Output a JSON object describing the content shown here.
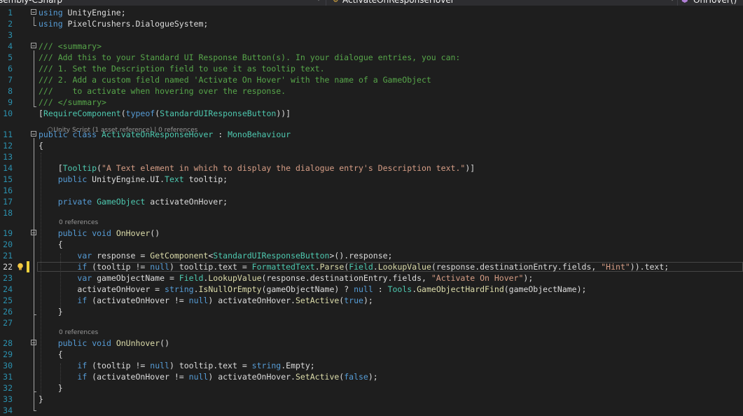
{
  "navbar": {
    "project_dropdown": "sembly-CSharp",
    "class_dropdown": "ActivateOnResponseHover",
    "member_dropdown": "OnHover()"
  },
  "colors": {
    "background": "#1e1e1e",
    "keyword": "#569cd6",
    "type": "#4ec9b0",
    "comment": "#57a64a",
    "string": "#d69d85",
    "method": "#dcdcaa",
    "text": "#dcdcdc",
    "line_number": "#2b91af",
    "modified_marker": "#efd23c"
  },
  "editor": {
    "current_line": 22,
    "code_lens": {
      "class_line10": "Unity Script (1 asset reference) | 0 references",
      "onhover": "0 references",
      "onunhover": "0 references"
    },
    "lightbulb_icon": "lightbulb-icon",
    "lines": [
      {
        "n": "1",
        "t": [
          [
            "kw",
            "using"
          ],
          [
            "tx",
            " UnityEngine;"
          ]
        ]
      },
      {
        "n": "2",
        "t": [
          [
            "kw",
            "using"
          ],
          [
            "tx",
            " PixelCrushers.DialogueSystem;"
          ]
        ]
      },
      {
        "n": "3",
        "t": []
      },
      {
        "n": "4",
        "t": [
          [
            "cm",
            "/// <summary>"
          ]
        ]
      },
      {
        "n": "5",
        "t": [
          [
            "cm",
            "/// Add this to your Standard UI Response Button(s). In your dialogue entries, you can:"
          ]
        ]
      },
      {
        "n": "6",
        "t": [
          [
            "cm",
            "/// 1. Set the Description field to use it as tooltip text."
          ]
        ]
      },
      {
        "n": "7",
        "t": [
          [
            "cm",
            "/// 2. Add a custom field named 'Activate On Hover' with the name of a GameObject"
          ]
        ]
      },
      {
        "n": "8",
        "t": [
          [
            "cm",
            "///    to activate when hovering over the response."
          ]
        ]
      },
      {
        "n": "9",
        "t": [
          [
            "cm",
            "/// </summary>"
          ]
        ]
      },
      {
        "n": "10",
        "t": [
          [
            "tx",
            "["
          ],
          [
            "ty",
            "RequireComponent"
          ],
          [
            "tx",
            "("
          ],
          [
            "kw",
            "typeof"
          ],
          [
            "tx",
            "("
          ],
          [
            "ty",
            "StandardUIResponseButton"
          ],
          [
            "tx",
            "))]"
          ]
        ]
      },
      {
        "n": "11",
        "t": [
          [
            "kw",
            "public"
          ],
          [
            "tx",
            " "
          ],
          [
            "kw",
            "class"
          ],
          [
            "tx",
            " "
          ],
          [
            "ty",
            "ActivateOnResponseHover"
          ],
          [
            "tx",
            " : "
          ],
          [
            "ty",
            "MonoBehaviour"
          ]
        ]
      },
      {
        "n": "12",
        "t": [
          [
            "tx",
            "{"
          ]
        ]
      },
      {
        "n": "13",
        "t": []
      },
      {
        "n": "14",
        "t": [
          [
            "tx",
            "    ["
          ],
          [
            "ty",
            "Tooltip"
          ],
          [
            "tx",
            "("
          ],
          [
            "st",
            "\"A Text element in which to display the dialogue entry's Description text.\""
          ],
          [
            "tx",
            ")]"
          ]
        ]
      },
      {
        "n": "15",
        "t": [
          [
            "tx",
            "    "
          ],
          [
            "kw",
            "public"
          ],
          [
            "tx",
            " UnityEngine.UI."
          ],
          [
            "ty",
            "Text"
          ],
          [
            "tx",
            " tooltip;"
          ]
        ]
      },
      {
        "n": "16",
        "t": []
      },
      {
        "n": "17",
        "t": [
          [
            "tx",
            "    "
          ],
          [
            "kw",
            "private"
          ],
          [
            "tx",
            " "
          ],
          [
            "ty",
            "GameObject"
          ],
          [
            "tx",
            " activateOnHover;"
          ]
        ]
      },
      {
        "n": "18",
        "t": []
      },
      {
        "n": "19",
        "t": [
          [
            "tx",
            "    "
          ],
          [
            "kw",
            "public"
          ],
          [
            "tx",
            " "
          ],
          [
            "kw",
            "void"
          ],
          [
            "tx",
            " "
          ],
          [
            "me",
            "OnHover"
          ],
          [
            "tx",
            "()"
          ]
        ]
      },
      {
        "n": "20",
        "t": [
          [
            "tx",
            "    {"
          ]
        ]
      },
      {
        "n": "21",
        "t": [
          [
            "tx",
            "        "
          ],
          [
            "kw",
            "var"
          ],
          [
            "tx",
            " response = "
          ],
          [
            "me",
            "GetComponent"
          ],
          [
            "tx",
            "<"
          ],
          [
            "ty",
            "StandardUIResponseButton"
          ],
          [
            "tx",
            ">().response;"
          ]
        ]
      },
      {
        "n": "22",
        "t": [
          [
            "tx",
            "        "
          ],
          [
            "kw",
            "if"
          ],
          [
            "tx",
            " (tooltip != "
          ],
          [
            "kw",
            "null"
          ],
          [
            "tx",
            ") tooltip.text = "
          ],
          [
            "ty",
            "FormattedText"
          ],
          [
            "tx",
            "."
          ],
          [
            "me",
            "Parse"
          ],
          [
            "tx",
            "("
          ],
          [
            "ty",
            "Field"
          ],
          [
            "tx",
            "."
          ],
          [
            "me",
            "LookupValue"
          ],
          [
            "tx",
            "(response.destinationEntry.fields, "
          ],
          [
            "st",
            "\"Hint\""
          ],
          [
            "tx",
            ")).text;"
          ]
        ]
      },
      {
        "n": "23",
        "t": [
          [
            "tx",
            "        "
          ],
          [
            "kw",
            "var"
          ],
          [
            "tx",
            " gameObjectName = "
          ],
          [
            "ty",
            "Field"
          ],
          [
            "tx",
            "."
          ],
          [
            "me",
            "LookupValue"
          ],
          [
            "tx",
            "(response.destinationEntry.fields, "
          ],
          [
            "st",
            "\"Activate On Hover\""
          ],
          [
            "tx",
            ");"
          ]
        ]
      },
      {
        "n": "24",
        "t": [
          [
            "tx",
            "        activateOnHover = "
          ],
          [
            "kw",
            "string"
          ],
          [
            "tx",
            "."
          ],
          [
            "me",
            "IsNullOrEmpty"
          ],
          [
            "tx",
            "(gameObjectName) ? "
          ],
          [
            "kw",
            "null"
          ],
          [
            "tx",
            " : "
          ],
          [
            "ty",
            "Tools"
          ],
          [
            "tx",
            "."
          ],
          [
            "me",
            "GameObjectHardFind"
          ],
          [
            "tx",
            "(gameObjectName);"
          ]
        ]
      },
      {
        "n": "25",
        "t": [
          [
            "tx",
            "        "
          ],
          [
            "kw",
            "if"
          ],
          [
            "tx",
            " (activateOnHover != "
          ],
          [
            "kw",
            "null"
          ],
          [
            "tx",
            ") activateOnHover."
          ],
          [
            "me",
            "SetActive"
          ],
          [
            "tx",
            "("
          ],
          [
            "kw",
            "true"
          ],
          [
            "tx",
            ");"
          ]
        ]
      },
      {
        "n": "26",
        "t": [
          [
            "tx",
            "    }"
          ]
        ]
      },
      {
        "n": "27",
        "t": []
      },
      {
        "n": "28",
        "t": [
          [
            "tx",
            "    "
          ],
          [
            "kw",
            "public"
          ],
          [
            "tx",
            " "
          ],
          [
            "kw",
            "void"
          ],
          [
            "tx",
            " "
          ],
          [
            "me",
            "OnUnhover"
          ],
          [
            "tx",
            "()"
          ]
        ]
      },
      {
        "n": "29",
        "t": [
          [
            "tx",
            "    {"
          ]
        ]
      },
      {
        "n": "30",
        "t": [
          [
            "tx",
            "        "
          ],
          [
            "kw",
            "if"
          ],
          [
            "tx",
            " (tooltip != "
          ],
          [
            "kw",
            "null"
          ],
          [
            "tx",
            ") tooltip.text = "
          ],
          [
            "kw",
            "string"
          ],
          [
            "tx",
            ".Empty;"
          ]
        ]
      },
      {
        "n": "31",
        "t": [
          [
            "tx",
            "        "
          ],
          [
            "kw",
            "if"
          ],
          [
            "tx",
            " (activateOnHover != "
          ],
          [
            "kw",
            "null"
          ],
          [
            "tx",
            ") activateOnHover."
          ],
          [
            "me",
            "SetActive"
          ],
          [
            "tx",
            "("
          ],
          [
            "kw",
            "false"
          ],
          [
            "tx",
            ");"
          ]
        ]
      },
      {
        "n": "32",
        "t": [
          [
            "tx",
            "    }"
          ]
        ]
      },
      {
        "n": "33",
        "t": [
          [
            "tx",
            "}"
          ]
        ]
      },
      {
        "n": "34",
        "t": []
      }
    ]
  }
}
